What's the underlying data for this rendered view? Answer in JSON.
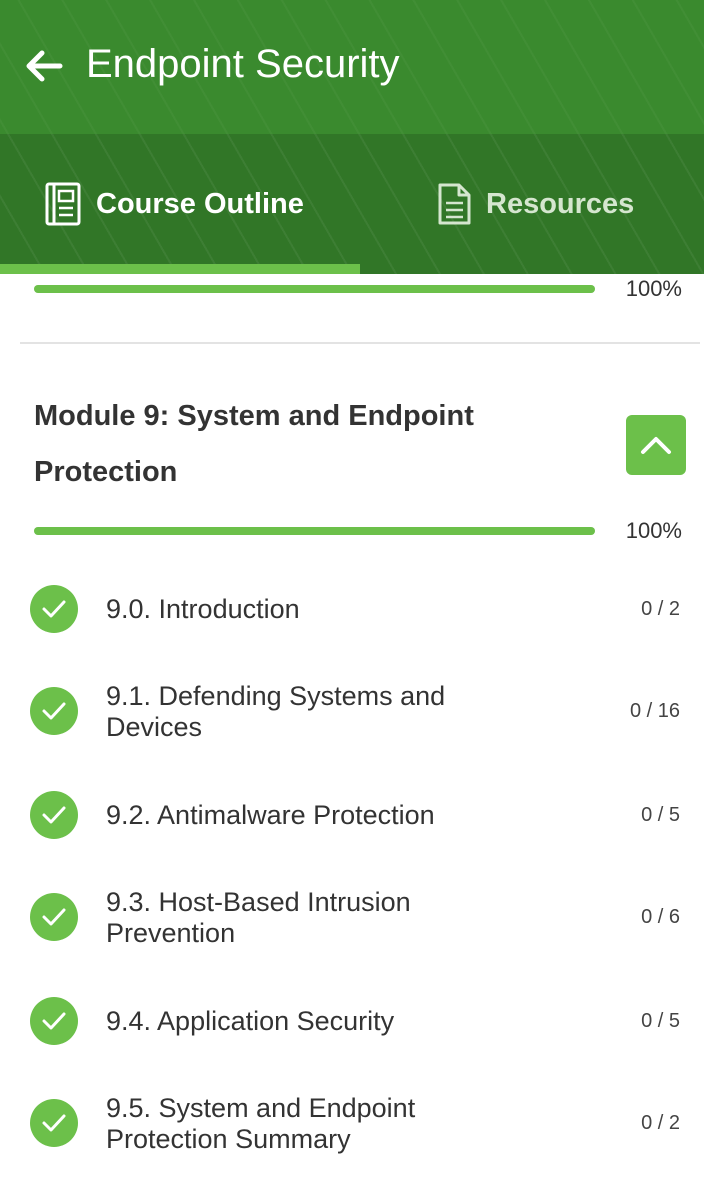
{
  "header": {
    "title": "Endpoint Security",
    "back_icon": "arrow-left-icon",
    "tabs": [
      {
        "label": "Course Outline",
        "icon": "notebook-icon",
        "active": true
      },
      {
        "label": "Resources",
        "icon": "document-icon",
        "active": false
      }
    ]
  },
  "colors": {
    "header_bg": "#3a8a2e",
    "accent": "#6cc04a",
    "text": "#333333"
  },
  "previous_module": {
    "progress_percent": 100,
    "progress_label": "100%"
  },
  "module": {
    "title": "Module 9: System and Endpoint Protection",
    "progress_percent": 100,
    "progress_label": "100%",
    "collapse_icon": "chevron-up-icon",
    "lessons": [
      {
        "title": "9.0. Introduction",
        "count": "0 / 2",
        "status_icon": "checkmark-icon"
      },
      {
        "title": "9.1. Defending Systems and Devices",
        "count": "0 / 16",
        "status_icon": "checkmark-icon"
      },
      {
        "title": "9.2. Antimalware Protection",
        "count": "0 / 5",
        "status_icon": "checkmark-icon"
      },
      {
        "title": "9.3. Host-Based Intrusion Prevention",
        "count": "0 / 6",
        "status_icon": "checkmark-icon"
      },
      {
        "title": "9.4. Application Security",
        "count": "0 / 5",
        "status_icon": "checkmark-icon"
      },
      {
        "title": "9.5. System and Endpoint Protection Summary",
        "count": "0 / 2",
        "status_icon": "checkmark-icon"
      }
    ]
  }
}
